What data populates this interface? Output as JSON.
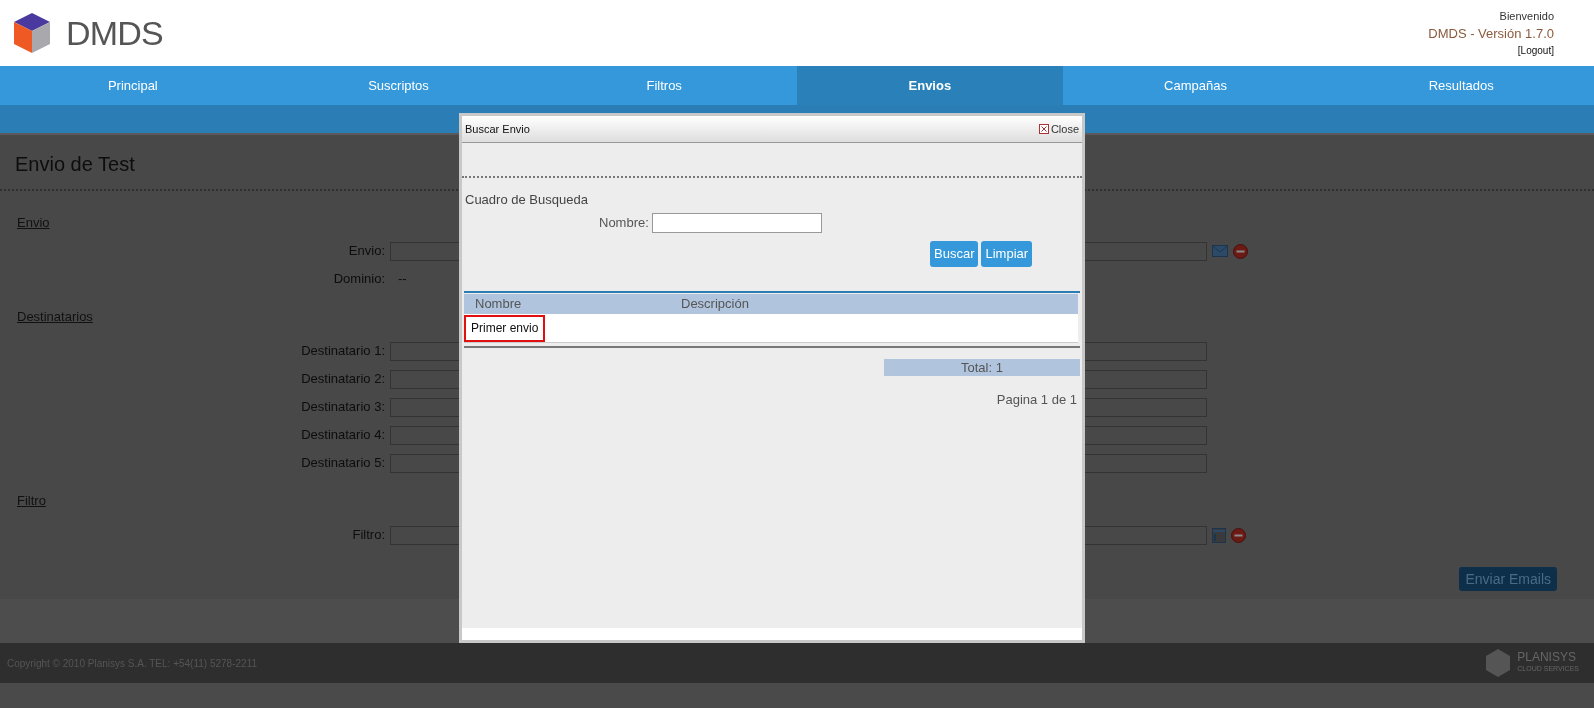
{
  "header": {
    "logo_text": "DMDS",
    "welcome": "Bienvenido",
    "version": "DMDS - Versión 1.7.0",
    "logout": "[Logout]"
  },
  "nav": [
    {
      "label": "Principal",
      "selected": false
    },
    {
      "label": "Suscriptos",
      "selected": false
    },
    {
      "label": "Filtros",
      "selected": false
    },
    {
      "label": "Envios",
      "selected": true
    },
    {
      "label": "Campañas",
      "selected": false
    },
    {
      "label": "Resultados",
      "selected": false
    }
  ],
  "page": {
    "title": "Envio de Test",
    "sections": [
      {
        "heading": "Envio",
        "fields": [
          {
            "kind": "input",
            "label": "Envio:",
            "actions": [
              {
                "kind": "mail"
              },
              {
                "kind": "remove"
              }
            ]
          },
          {
            "kind": "text",
            "label": "Dominio:",
            "value": "--"
          }
        ]
      },
      {
        "heading": "Destinatarios",
        "fields": [
          {
            "kind": "input",
            "label": "Destinatario 1:"
          },
          {
            "kind": "input",
            "label": "Destinatario 2:"
          },
          {
            "kind": "input",
            "label": "Destinatario 3:"
          },
          {
            "kind": "input",
            "label": "Destinatario 4:"
          },
          {
            "kind": "input",
            "label": "Destinatario 5:"
          }
        ]
      },
      {
        "heading": "Filtro",
        "fields": [
          {
            "kind": "input",
            "label": "Filtro:",
            "actions": [
              {
                "kind": "panel"
              },
              {
                "kind": "remove"
              }
            ]
          }
        ]
      }
    ],
    "submit": "Enviar Emails"
  },
  "footer": {
    "copyright": "Copyright © 2010 Planisys S.A. TEL: +54(11) 5278-2211",
    "brand": "PLANISYS",
    "brand_sub": "CLOUD SERVICES"
  },
  "dialog": {
    "title": "Buscar Envio",
    "close": "Close",
    "search_heading": "Cuadro de Busqueda",
    "name_label": "Nombre:",
    "buttons": [
      "Buscar",
      "Limpiar"
    ],
    "table": {
      "columns": [
        "Nombre",
        "Descripción"
      ],
      "rows": [
        {
          "cells": [
            "Primer envio",
            ""
          ],
          "highlighted": true
        }
      ]
    },
    "total": "Total: 1",
    "pagination": "Pagina 1 de 1"
  }
}
